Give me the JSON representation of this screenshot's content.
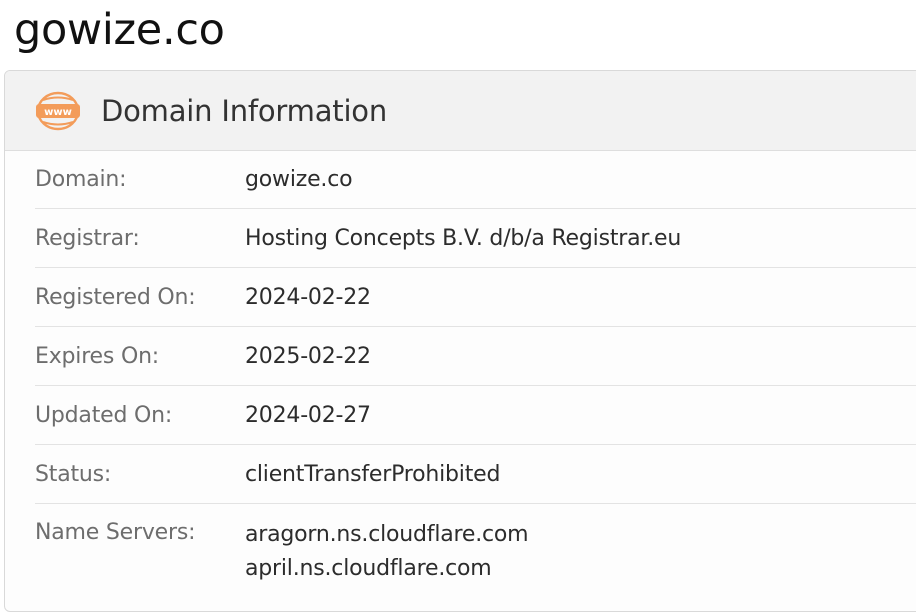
{
  "page": {
    "title": "gowize.co"
  },
  "card": {
    "icon": "www-globe-icon",
    "title": "Domain Information",
    "accent": "#f39c5a"
  },
  "fields": {
    "domain": {
      "label": "Domain:",
      "value": "gowize.co"
    },
    "registrar": {
      "label": "Registrar:",
      "value": "Hosting Concepts B.V. d/b/a Registrar.eu"
    },
    "registered_on": {
      "label": "Registered On:",
      "value": "2024-02-22"
    },
    "expires_on": {
      "label": "Expires On:",
      "value": "2025-02-22"
    },
    "updated_on": {
      "label": "Updated On:",
      "value": "2024-02-27"
    },
    "status": {
      "label": "Status:",
      "value": "clientTransferProhibited"
    },
    "name_servers": {
      "label": "Name Servers:",
      "values": [
        "aragorn.ns.cloudflare.com",
        "april.ns.cloudflare.com"
      ]
    }
  }
}
